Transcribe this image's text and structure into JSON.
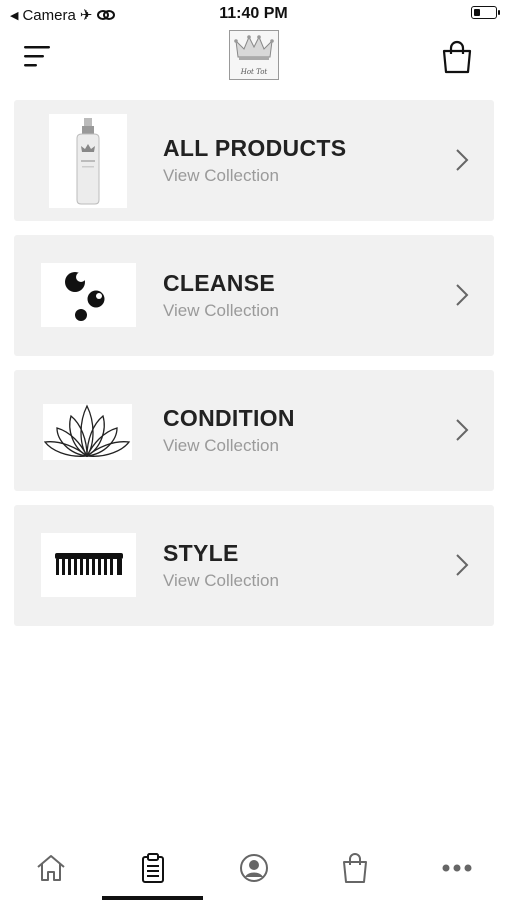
{
  "status_bar": {
    "back_app": "Camera",
    "time": "11:40 PM"
  },
  "header": {
    "menu_icon": "hamburger-menu-icon",
    "logo_text": "Hot Tot",
    "cart_icon": "shopping-bag-icon"
  },
  "collections": [
    {
      "title": "ALL PRODUCTS",
      "subtitle": "View Collection",
      "image": "product-bottle"
    },
    {
      "title": "CLEANSE",
      "subtitle": "View Collection",
      "image": "bubbles"
    },
    {
      "title": "CONDITION",
      "subtitle": "View Collection",
      "image": "lotus"
    },
    {
      "title": "STYLE",
      "subtitle": "View Collection",
      "image": "comb"
    }
  ],
  "tab_bar": {
    "items": [
      {
        "icon": "home-icon"
      },
      {
        "icon": "clipboard-icon",
        "selected": true
      },
      {
        "icon": "account-icon"
      },
      {
        "icon": "shopping-bag-icon"
      },
      {
        "icon": "more-icon"
      }
    ]
  }
}
